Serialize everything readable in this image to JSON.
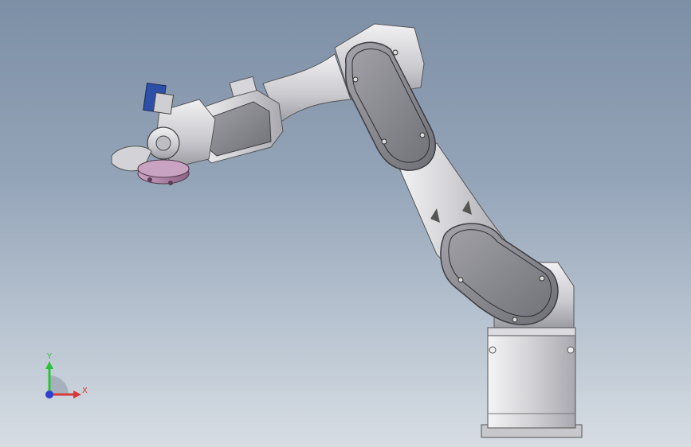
{
  "viewport": {
    "background_top": "#7d8fa6",
    "background_bottom": "#d7dde3"
  },
  "model": {
    "subject": "six-axis-robot-arm-with-grinder",
    "body_color": "#cfcfd3",
    "cover_color": "#8d8d93",
    "tool_color": "#b083a8",
    "motor_color": "#2d4fa8"
  },
  "triad": {
    "x_label": "X",
    "y_label": "Y",
    "x_color": "#d63a3a",
    "y_color": "#2ec23a",
    "z_color": "#2f3fd1"
  }
}
